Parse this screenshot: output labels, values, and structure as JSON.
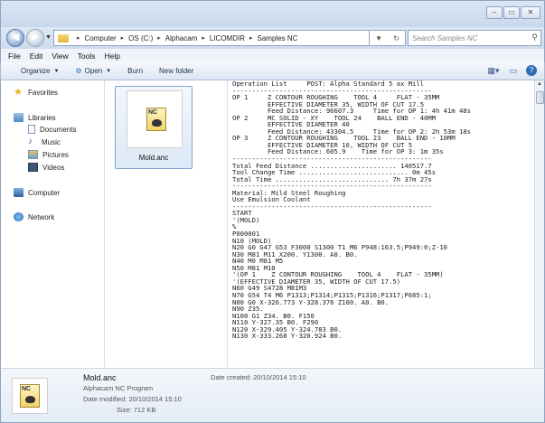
{
  "window": {
    "minimize": "–",
    "maximize": "▭",
    "close": "✕"
  },
  "address": {
    "crumbs": [
      "Computer",
      "OS (C:)",
      "Alphacam",
      "LICOMDIR",
      "Samples NC"
    ],
    "refresh": "↻",
    "search_placeholder": "Search Samples NC"
  },
  "menu": [
    "File",
    "Edit",
    "View",
    "Tools",
    "Help"
  ],
  "toolbar": {
    "organize": "Organize",
    "open": "Open",
    "burn": "Burn",
    "new_folder": "New folder"
  },
  "sidebar": {
    "favorites": "Favorites",
    "libraries": "Libraries",
    "documents": "Documents",
    "music": "Music",
    "pictures": "Pictures",
    "videos": "Videos",
    "computer": "Computer",
    "network": "Network"
  },
  "file": {
    "name": "Mold.anc",
    "icon_text": "NC"
  },
  "preview": {
    "lines": [
      "Operation List     POST: Alpha Standard 5 ax Mill",
      "---------------------------------------------------",
      "OP 1     Z CONTOUR ROUGHING    TOOL 4     FLAT - 35MM",
      "         EFFECTIVE DIAMETER 35, WIDTH OF CUT 17.5",
      "         Feed Distance: 96607.3     Time for OP 1: 4h 41m 48s",
      "OP 2     MC SOLID - XY    TOOL 24    BALL END - 40MM",
      "         EFFECTIVE DIAMETER 40",
      "         Feed Distance: 43304.5     Time for OP 2: 2h 53m 18s",
      "OP 3     Z CONTOUR ROUGHING    TOOL 23    BALL END - 10MM",
      "         EFFECTIVE DIAMETER 10, WIDTH OF CUT 5",
      "         Feed Distance: 605.9    Time for OP 3: 1m 35s",
      "---------------------------------------------------",
      "Total Feed Distance ...................... 140517.7",
      "Tool Change Time ............................ 0m 45s",
      "Total Time ............................. 7h 37m 27s",
      "---------------------------------------------------",
      "Material: Mild Steel Roughing",
      "Use Emulsion Coolant",
      "---------------------------------------------------",
      "START",
      "'(MOLD)",
      "%",
      "P000001",
      "N10 (MOLD)",
      "N20 G0 G47 G53 F3000 S1300 T1 M6 P948:163.5;P949:0;Z-10",
      "N30 M81 M11 X200. Y1300. A0. B0.",
      "N40 M0 M81 M5",
      "N50 M81 M10",
      "'(OP 1    Z CONTOUR ROUGHING    TOOL 4    FLAT - 35MM)",
      "'(EFFECTIVE DIAMETER 35, WIDTH OF CUT 17.5)",
      "N60 G49 S4728 M81M3",
      "N70 G54 T4 M6 P1313;P1314;P1315;P1316;P1317;P685:1;",
      "N80 G0 X-326.773 Y-328.376 Z100. A0. B0.",
      "N90 Z35.",
      "N100 G1 Z34. B0. F150",
      "N110 Y-327.35 B0. F290",
      "N120 X-329.405 Y-324.783 B0.",
      "N130 X-333.268 Y-320.924 B0."
    ]
  },
  "details": {
    "name": "Mold.anc",
    "type": "Alphacam NC Program",
    "modified": "Date modified: 20/10/2014 15:10",
    "size": "Size: 712 KB",
    "created": "Date created: 20/10/2014 15:10"
  }
}
